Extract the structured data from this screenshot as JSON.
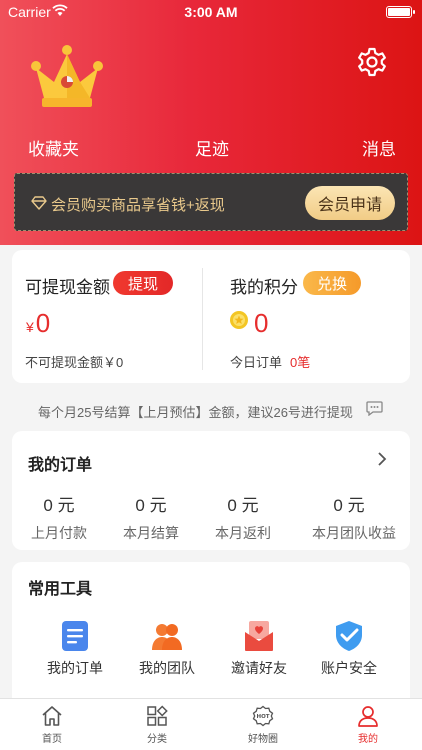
{
  "status_bar": {
    "carrier": "Carrier",
    "time": "3:00 AM"
  },
  "header": {
    "links": {
      "favorites": "收藏夹",
      "footprints": "足迹",
      "messages": "消息"
    },
    "icons": [
      "crown-icon",
      "gear-icon"
    ]
  },
  "vip_banner": {
    "text": "会员购买商品享省钱+返现",
    "button": "会员申请"
  },
  "wallet": {
    "withdrawable_label": "可提现金额",
    "withdraw_button": "提现",
    "currency": "¥",
    "withdrawable_amount": "0",
    "non_withdrawable": "不可提现金额￥0",
    "points_label": "我的积分",
    "exchange_button": "兑换",
    "points_amount": "0",
    "today_orders_label": "今日订单",
    "today_orders_value": "0笔"
  },
  "notice": "每个月25号结算【上月预估】金额，建议26号进行提现",
  "orders": {
    "title": "我的订单",
    "stats": [
      {
        "value": "0 元",
        "label": "上月付款"
      },
      {
        "value": "0 元",
        "label": "本月结算"
      },
      {
        "value": "0 元",
        "label": "本月返利"
      },
      {
        "value": "0 元",
        "label": "本月团队收益"
      }
    ]
  },
  "tools": {
    "title": "常用工具",
    "items": [
      {
        "label": "我的订单",
        "icon": "order-list-icon"
      },
      {
        "label": "我的团队",
        "icon": "team-icon"
      },
      {
        "label": "邀请好友",
        "icon": "invite-envelope-icon"
      },
      {
        "label": "账户安全",
        "icon": "shield-check-icon"
      }
    ]
  },
  "tabbar": {
    "items": [
      {
        "label": "首页",
        "icon": "home-icon"
      },
      {
        "label": "分类",
        "icon": "category-icon"
      },
      {
        "label": "好物圈",
        "icon": "hot-badge-icon"
      },
      {
        "label": "我的",
        "icon": "user-icon"
      }
    ],
    "active": "我的"
  },
  "colors": {
    "accent_red": "#e62d2d",
    "vip_gold": "#e9c98c",
    "orange": "#f59a2a"
  }
}
